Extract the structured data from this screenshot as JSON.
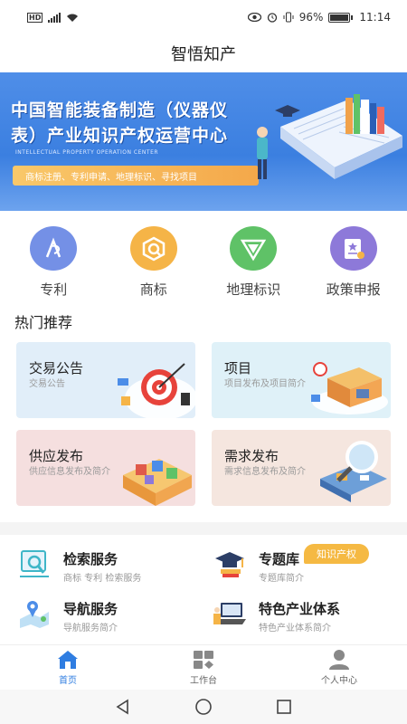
{
  "status_bar": {
    "network": "HD",
    "battery_percent": "96%",
    "time": "11:14",
    "battery_level": 0.96
  },
  "title": "智悟知产",
  "banner": {
    "line1": "中国智能装备制造（仪器仪",
    "line2": "表）产业知识产权运营中心",
    "english": "INTELLECTUAL PROPERTY OPERATION CENTER",
    "tags": "商标注册、专利申请、地理标识、寻找项目"
  },
  "quick_entries": [
    {
      "label": "专利",
      "icon": "patent-icon",
      "color": "#6f8de6"
    },
    {
      "label": "商标",
      "icon": "trademark-icon",
      "color": "#f5b447"
    },
    {
      "label": "地理标识",
      "icon": "geo-mark-icon",
      "color": "#5fc267"
    },
    {
      "label": "政策申报",
      "icon": "policy-icon",
      "color": "#8d79d9"
    }
  ],
  "hot_section_title": "热门推荐",
  "hot_cards": [
    {
      "title": "交易公告",
      "desc": "交易公告",
      "icon": "target-icon",
      "bg": "#dfeefa"
    },
    {
      "title": "项目",
      "desc": "项目发布及项目简介",
      "icon": "store-icon",
      "bg": "#dff1f8"
    },
    {
      "title": "供应发布",
      "desc": "供应信息发布及简介",
      "icon": "warehouse-icon",
      "bg": "#f5dede"
    },
    {
      "title": "需求发布",
      "desc": "需求信息发布及简介",
      "icon": "magnifier-icon",
      "bg": "#f5e5de"
    }
  ],
  "services": [
    {
      "title": "检索服务",
      "desc": "商标 专利 检索服务",
      "icon": "search-service-icon"
    },
    {
      "title": "专题库",
      "desc": "专题库简介",
      "icon": "graduation-cap-icon"
    },
    {
      "title": "导航服务",
      "desc": "导航服务简介",
      "icon": "navigation-map-icon"
    },
    {
      "title": "特色产业体系",
      "desc": "特色产业体系简介",
      "icon": "industry-laptop-icon"
    }
  ],
  "service_badge": "知识产权",
  "tabs": [
    {
      "label": "首页",
      "icon": "home-icon",
      "active": true
    },
    {
      "label": "工作台",
      "icon": "workbench-icon",
      "active": false
    },
    {
      "label": "个人中心",
      "icon": "user-icon",
      "active": false
    }
  ],
  "colors": {
    "accent": "#2f7de1",
    "banner": "#3b7fe0",
    "badge": "#f5b943"
  }
}
